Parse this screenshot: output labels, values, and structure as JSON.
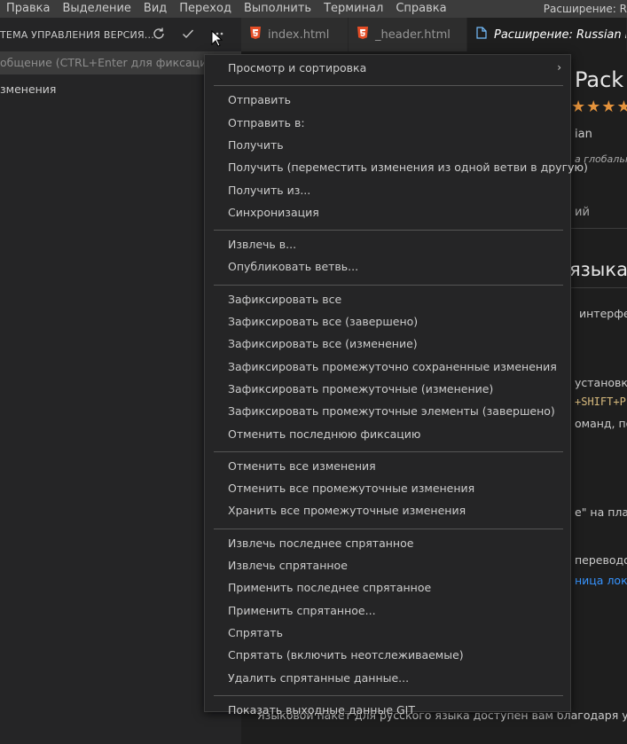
{
  "menubar": {
    "items": [
      "Правка",
      "Выделение",
      "Вид",
      "Переход",
      "Выполнить",
      "Терминал",
      "Справка"
    ],
    "window_title": "Расширение: R"
  },
  "sidebar": {
    "title": "ТЕМА УПРАВЛЕНИЯ ВЕРСИЯ...",
    "commit_placeholder": "общение (CTRL+Enter для фиксации в \"",
    "changes_label": "зменения",
    "icons": [
      "refresh-icon",
      "check-icon",
      "more-icon"
    ]
  },
  "tabs": [
    {
      "label": "index.html",
      "icon": "html5-icon",
      "active": false
    },
    {
      "label": "_header.html",
      "icon": "html5-icon",
      "active": false
    },
    {
      "label": "Расширение: Russian Lang",
      "icon": "file-icon",
      "active": true
    }
  ],
  "editor": {
    "title_fragment": "Pack",
    "stars": "★★★★",
    "publisher_fragment": "ian",
    "desc_fragment": "а глобально",
    "tab_fragment": "ий",
    "heading_fragment": "языка",
    "lines": [
      "интерфей",
      "установки",
      "+SHIFT+P",
      "оманд, пос",
      "e\" на плат",
      "переводов",
      "ница локал"
    ],
    "bottom_text": "Языковой пакет для русского языка доступен вам благодаря усилиям"
  },
  "context_menu": {
    "groups": [
      [
        "Просмотр и сортировка"
      ],
      [
        "Отправить",
        "Отправить в:",
        "Получить",
        "Получить (переместить изменения из одной ветви в другую)",
        "Получить из...",
        "Синхронизация"
      ],
      [
        "Извлечь в...",
        "Опубликовать ветвь..."
      ],
      [
        "Зафиксировать все",
        "Зафиксировать все (завершено)",
        "Зафиксировать все (изменение)",
        "Зафиксировать промежуточно сохраненные изменения",
        "Зафиксировать промежуточные (изменение)",
        "Зафиксировать промежуточные элементы (завершено)",
        "Отменить последнюю фиксацию"
      ],
      [
        "Отменить все изменения",
        "Отменить все промежуточные изменения",
        "Хранить все промежуточные изменения"
      ],
      [
        "Извлечь последнее спрятанное",
        "Извлечь спрятанное",
        "Применить последнее спрятанное",
        "Применить спрятанное...",
        "Спрятать",
        "Спрятать (включить неотслеживаемые)",
        "Удалить спрятанные данные..."
      ],
      [
        "Показать выходные данные GIT"
      ]
    ],
    "submenu_arrow": "›"
  },
  "colors": {
    "menu_bg": "#252526",
    "accent_link": "#3794ff",
    "star": "#e5933c",
    "keybinding": "#d7ba7d"
  }
}
